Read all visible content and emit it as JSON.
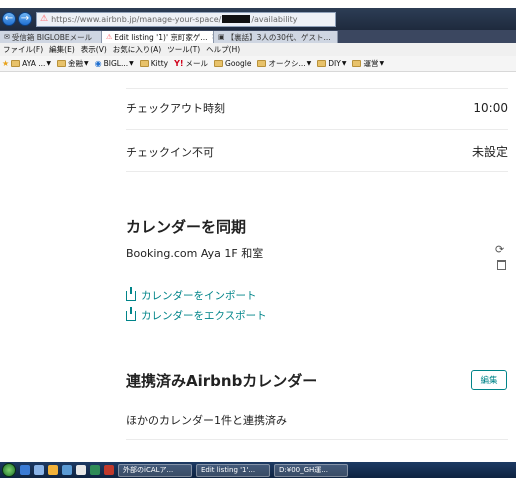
{
  "browser": {
    "url_prefix": "https://www.airbnb.jp/manage-your-space/",
    "url_suffix": "/availability",
    "tabs": [
      {
        "label": "受信箱 BIGLOBEメール",
        "active": false,
        "icon": "mail-icon"
      },
      {
        "label": "Edit listing '1)' 京町家ゲ...",
        "active": true,
        "icon": "airbnb-icon"
      },
      {
        "label": "【裏話】3人の30代、ゲスト...",
        "active": false,
        "icon": "page-icon"
      }
    ],
    "menu": [
      "ファイル(F)",
      "編集(E)",
      "表示(V)",
      "お気に入り(A)",
      "ツール(T)",
      "ヘルプ(H)"
    ],
    "favorites": [
      {
        "label": "AYA ...",
        "type": "folder"
      },
      {
        "label": "金融",
        "type": "folder"
      },
      {
        "label": "BIGL...",
        "type": "site"
      },
      {
        "label": "Kitty",
        "type": "folder"
      },
      {
        "label": "メール",
        "type": "yahoo"
      },
      {
        "label": "Google",
        "type": "folder"
      },
      {
        "label": "オークシ...",
        "type": "folder"
      },
      {
        "label": "DIY",
        "type": "folder"
      },
      {
        "label": "運営",
        "type": "folder"
      }
    ]
  },
  "settings": {
    "checkout_label": "チェックアウト時刻",
    "checkout_value": "10:00",
    "no_checkin_label": "チェックイン不可",
    "no_checkin_value": "未設定"
  },
  "sync": {
    "title": "カレンダーを同期",
    "calendar_name": "Booking.com Aya 1F 和室",
    "import_label": "カレンダーをインポート",
    "export_label": "カレンダーをエクスポート"
  },
  "airbnb_calendars": {
    "title": "連携済みAirbnbカレンダー",
    "edit_label": "編集",
    "status": "ほかのカレンダー1件と連携済み"
  },
  "taskbar": {
    "tasks": [
      "外部のiCALア...",
      "Edit listing '1'...",
      "D:¥00_GH運..."
    ]
  }
}
